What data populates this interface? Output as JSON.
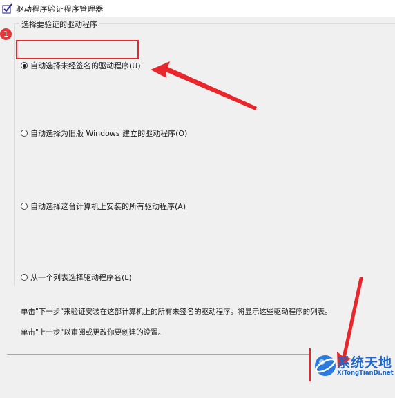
{
  "window": {
    "title": "驱动程序验证程序管理器"
  },
  "group": {
    "label": "选择要验证的驱动程序"
  },
  "options": [
    {
      "label": "自动选择未经签名的驱动程序(U)",
      "selected": true
    },
    {
      "label": "自动选择为旧版 Windows 建立的驱动程序(O)",
      "selected": false
    },
    {
      "label": "自动选择这台计算机上安装的所有驱动程序(A)",
      "selected": false
    },
    {
      "label": "从一个列表选择驱动程序名(L)",
      "selected": false
    }
  ],
  "description": {
    "next": "单击\"下一步\"来验证安装在这部计算机上的所有未签名的驱动程序。将显示这些驱动程序的列表。",
    "back": "单击\"上一步\"以审阅或更改你要创建的设置。"
  },
  "annotation": {
    "badge": "1",
    "color": "#e8262b"
  },
  "watermark": {
    "brand_cn": "系统天地",
    "brand_en": "XiTongTianDi.net",
    "color": "#1e66c8"
  }
}
